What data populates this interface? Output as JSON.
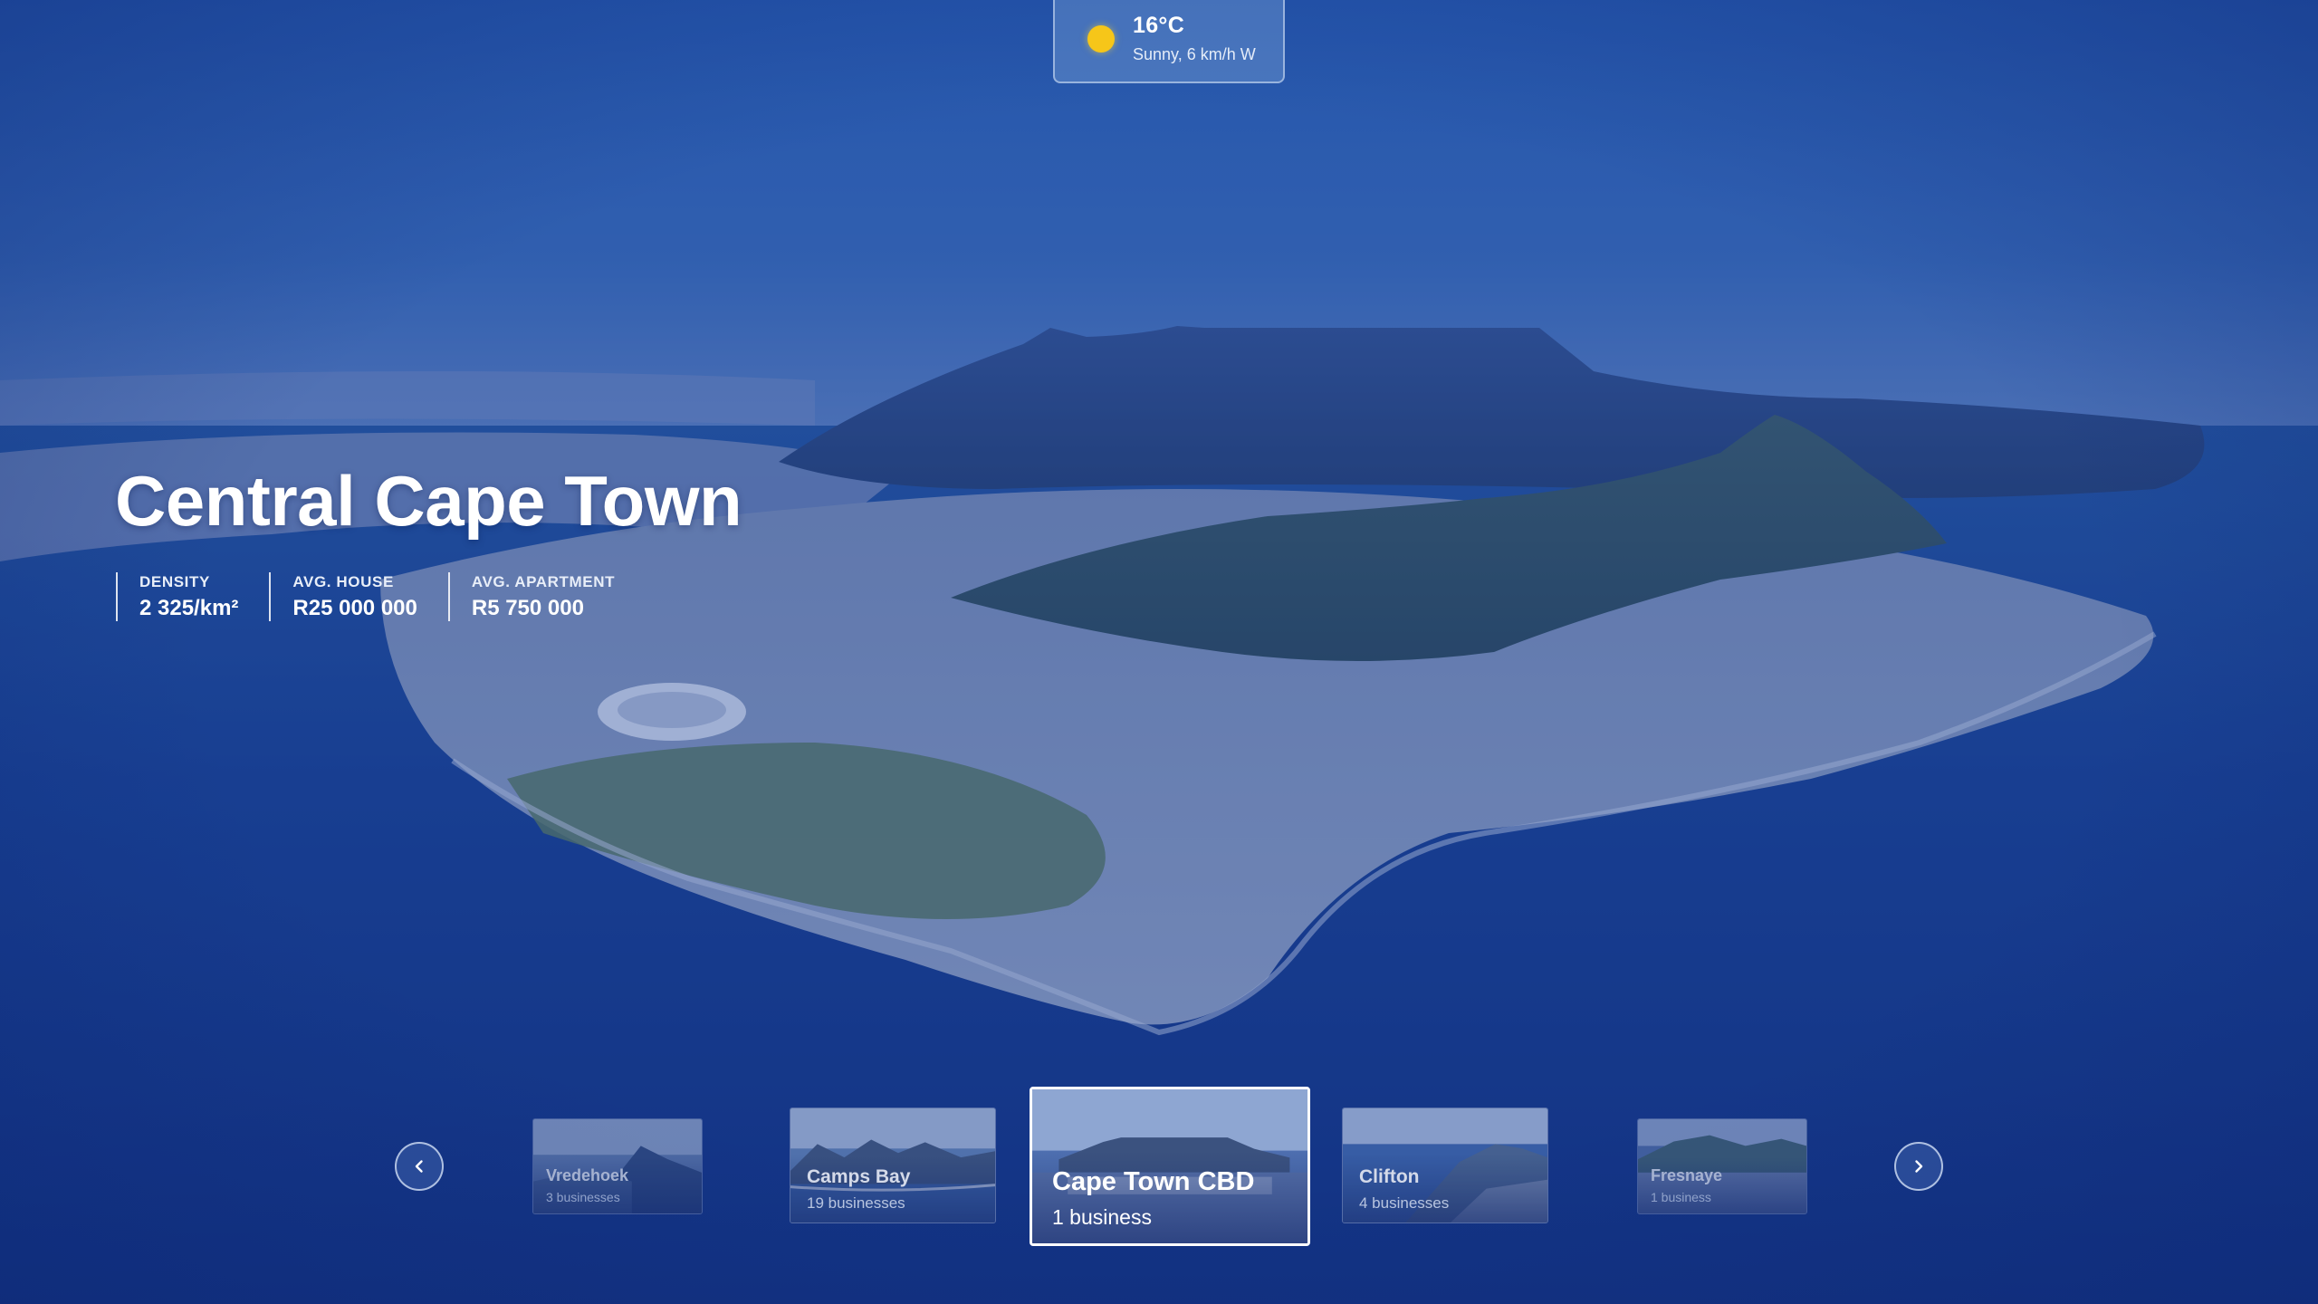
{
  "weather": {
    "temperature": "16°C",
    "description": "Sunny, 6 km/h W",
    "icon": "sun-icon",
    "icon_color": "#f6c619"
  },
  "hero": {
    "title": "Central Cape Town",
    "stats": [
      {
        "label": "DENSITY",
        "value": "2 325/km²"
      },
      {
        "label": "AVG. HOUSE",
        "value": "R25 000 000"
      },
      {
        "label": "AVG. APARTMENT",
        "value": "R5 750 000"
      }
    ]
  },
  "carousel": {
    "prev_icon": "chevron-left-icon",
    "next_icon": "chevron-right-icon",
    "suburbs": [
      {
        "name": "Vredehoek",
        "count": "3 businesses"
      },
      {
        "name": "Camps Bay",
        "count": "19 businesses"
      },
      {
        "name": "Cape Town CBD",
        "count": "1 business",
        "active": true
      },
      {
        "name": "Clifton",
        "count": "4 businesses"
      },
      {
        "name": "Fresnaye",
        "count": "1 business"
      }
    ]
  },
  "colors": {
    "overlay_blue": "#1c3f94",
    "sky": "#2f67b8",
    "ocean": "#123a8c"
  }
}
